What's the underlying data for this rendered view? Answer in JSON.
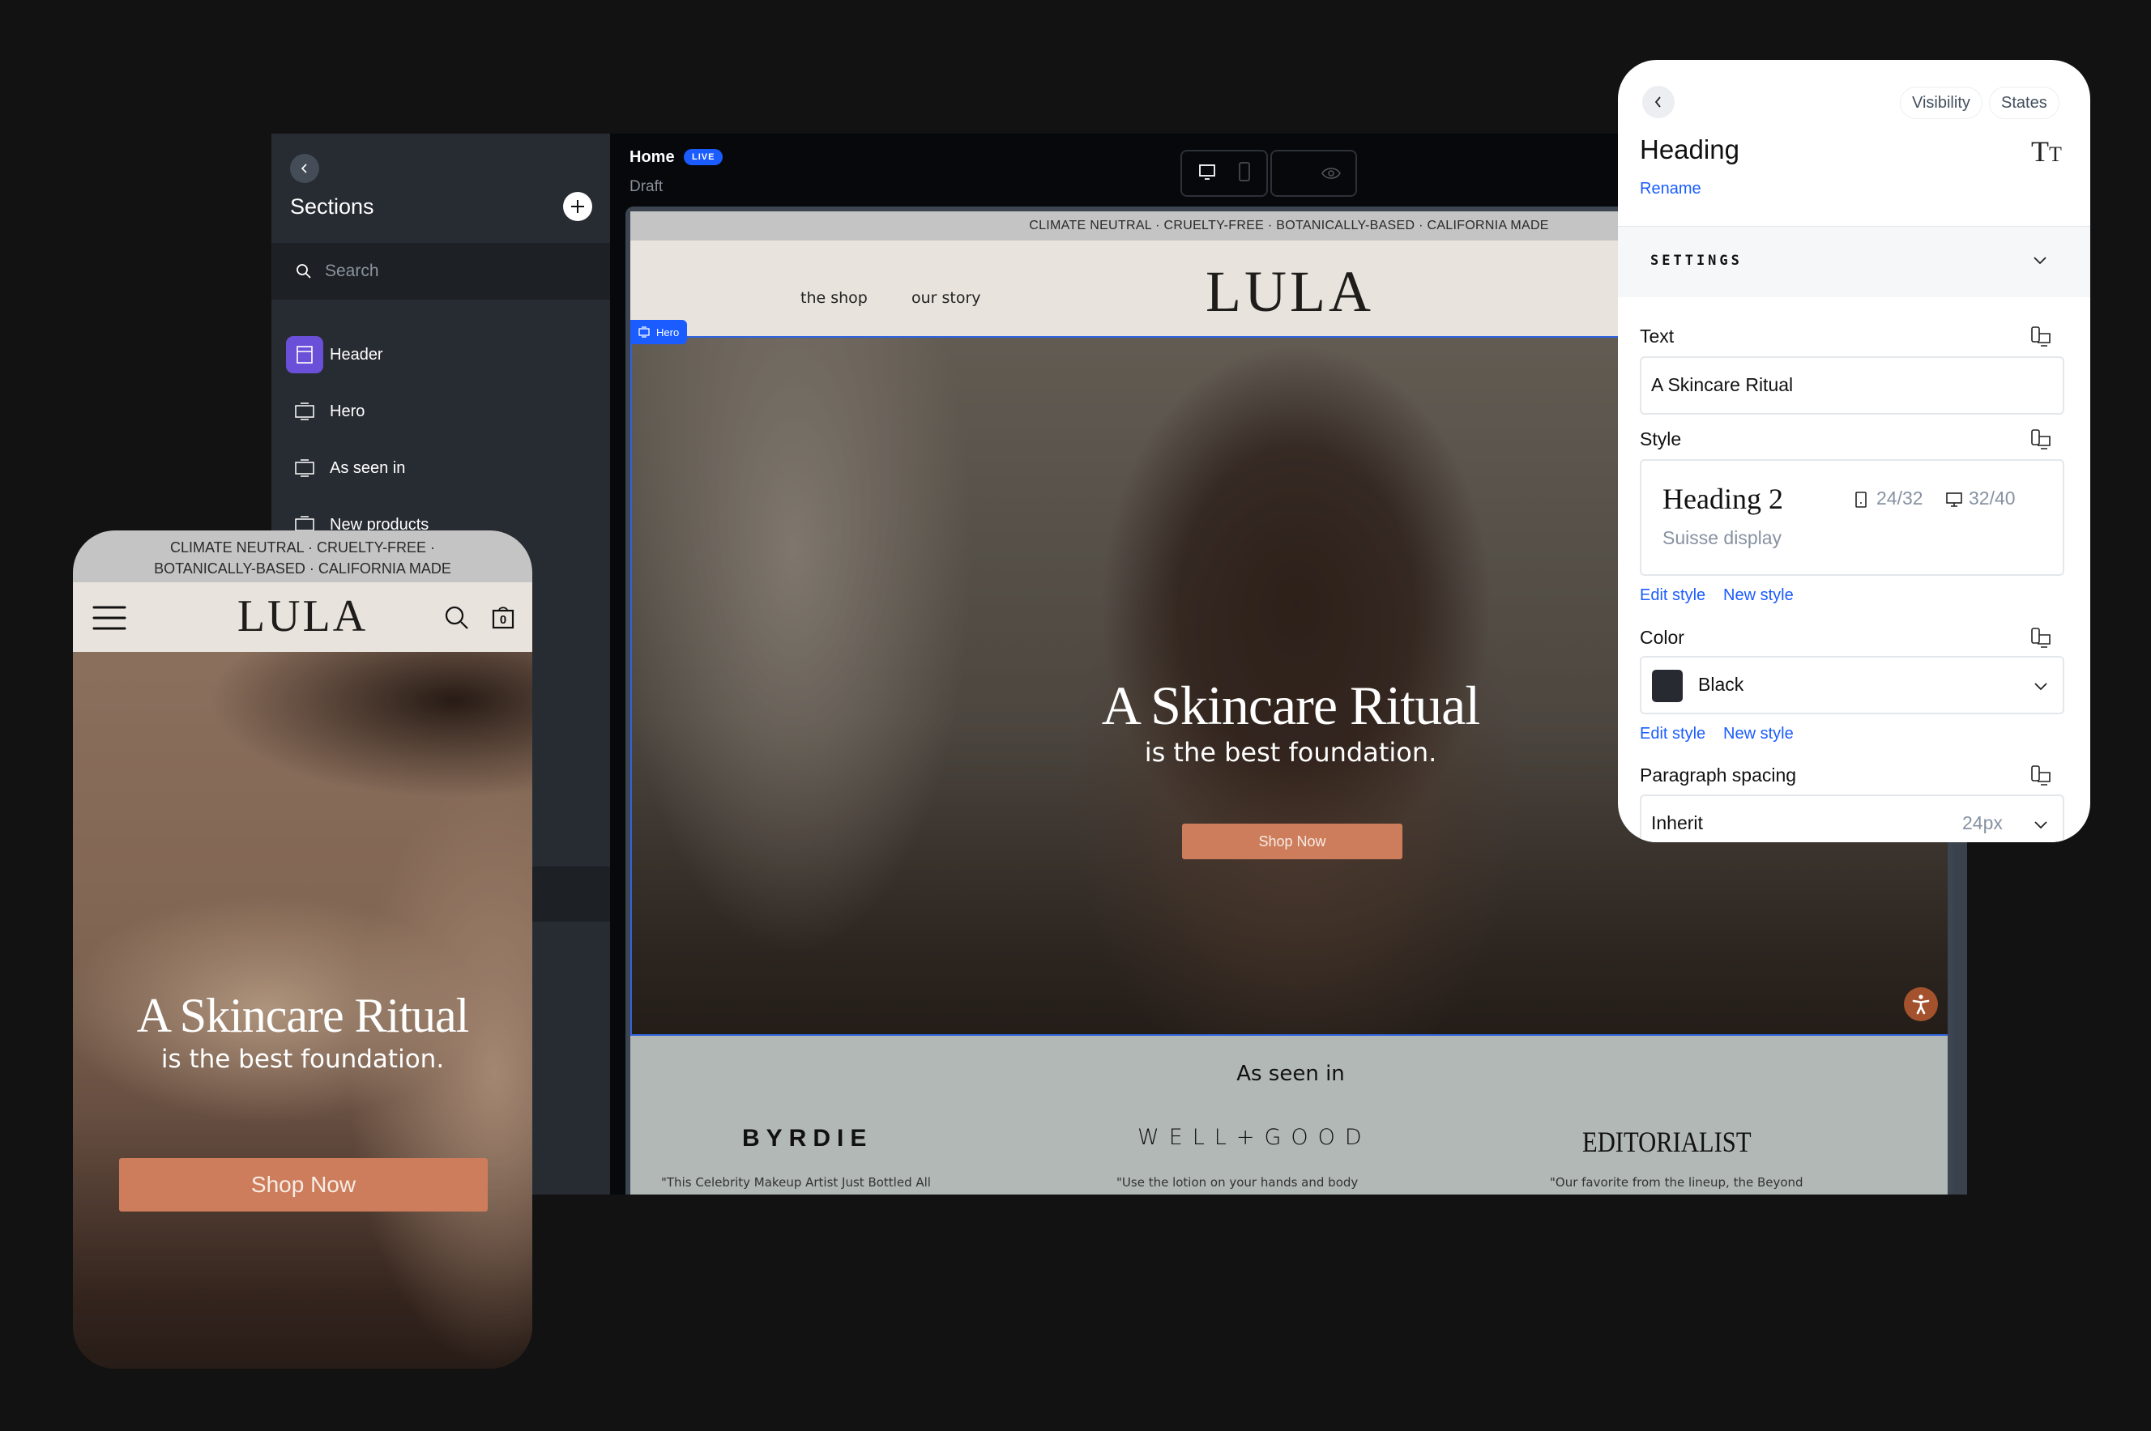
{
  "sidebar": {
    "title": "Sections",
    "search_placeholder": "Search",
    "items": [
      {
        "label": "Header",
        "icon": "header-layout-icon",
        "active": true
      },
      {
        "label": "Hero",
        "icon": "section-icon"
      },
      {
        "label": "As seen in",
        "icon": "section-icon"
      },
      {
        "label": "New products",
        "icon": "section-icon"
      }
    ]
  },
  "topbar": {
    "page_name": "Home",
    "status_badge": "LIVE",
    "state": "Draft",
    "view_buttons": [
      "desktop-icon",
      "mobile-icon",
      "eye-icon"
    ]
  },
  "site": {
    "announcement": "CLIMATE NEUTRAL · CRUELTY-FREE · BOTANICALLY-BASED · CALIFORNIA MADE",
    "nav": [
      "the shop",
      "our story"
    ],
    "logo": "LULA",
    "selected_section_tag": "Hero",
    "hero": {
      "heading": "A Skincare Ritual",
      "subheading": "is the best foundation.",
      "cta": "Shop Now"
    },
    "as_seen_in": {
      "title": "As seen in",
      "brands": [
        {
          "name": "BYRDIE",
          "quote": "\"This Celebrity Makeup Artist Just Bottled All"
        },
        {
          "name": "WELL+GOOD",
          "quote": "\"Use the lotion on your hands and body"
        },
        {
          "name": "EDITORIALIST",
          "quote": "\"Our favorite from the lineup, the Beyond"
        }
      ]
    }
  },
  "panel": {
    "tabs": [
      "Visibility",
      "States"
    ],
    "title": "Heading",
    "rename": "Rename",
    "section": "SETTINGS",
    "text_label": "Text",
    "text_value": "A Skincare Ritual",
    "style_label": "Style",
    "style_name": "Heading 2",
    "style_font": "Suisse display",
    "style_mobile": "24/32",
    "style_desktop": "32/40",
    "edit_style": "Edit style",
    "new_style": "New style",
    "color_label": "Color",
    "color_value": "Black",
    "color_swatch": "#272a30",
    "spacing_label": "Paragraph spacing",
    "spacing_value": "Inherit",
    "spacing_px": "24px"
  },
  "mobile": {
    "announcement_line1": "CLIMATE NEUTRAL · CRUELTY-FREE ·",
    "announcement_line2": "BOTANICALLY-BASED · CALIFORNIA MADE",
    "logo": "LULA",
    "cart_count": "0",
    "heading": "A Skincare Ritual",
    "subheading": "is the best foundation.",
    "cta": "Shop Now"
  }
}
